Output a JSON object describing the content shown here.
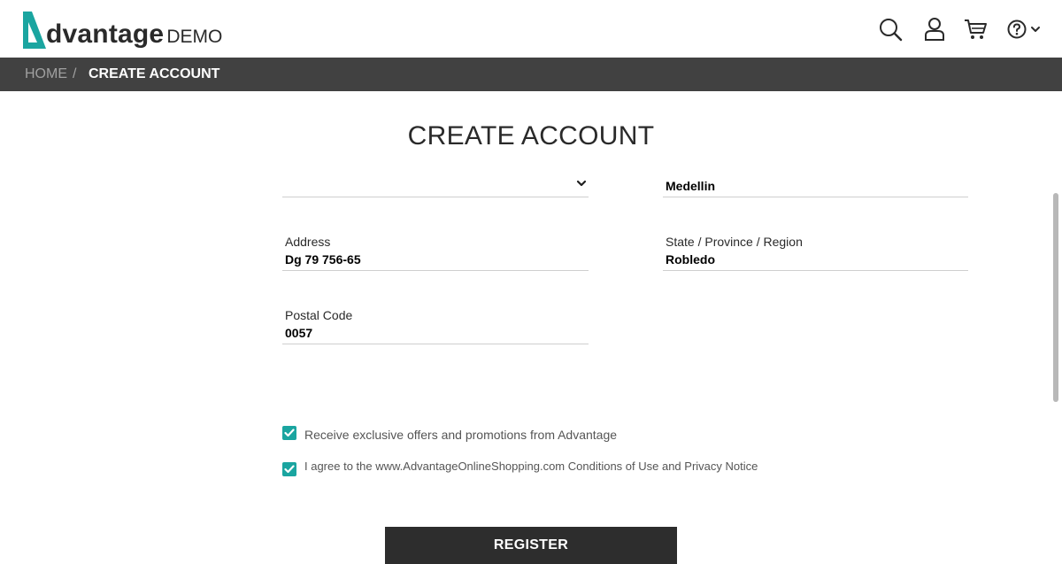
{
  "header": {
    "logo_text": "dvantage",
    "logo_demo": "DEMO",
    "icons": [
      "search-icon",
      "user-icon",
      "cart-icon",
      "help-icon",
      "chevron-down-icon"
    ]
  },
  "breadcrumb": {
    "home": "HOME",
    "separator": "/",
    "current": "CREATE ACCOUNT"
  },
  "page": {
    "title": "CREATE ACCOUNT"
  },
  "form": {
    "country_value": "",
    "city_value": "Medellin",
    "address_label": "Address",
    "address_value": "Dg 79 756-65",
    "state_label": "State / Province / Region",
    "state_value": "Robledo",
    "postal_label": "Postal Code",
    "postal_value": "0057"
  },
  "checkboxes": {
    "offers_label": "Receive exclusive offers and promotions from Advantage",
    "offers_checked": true,
    "terms_label": "I agree to the www.AdvantageOnlineShopping.com Conditions of Use and Privacy Notice",
    "terms_checked": true
  },
  "actions": {
    "register_label": "REGISTER"
  },
  "colors": {
    "accent": "#1aa5a0",
    "header_bar": "#414141",
    "button": "#2d2d2d"
  }
}
